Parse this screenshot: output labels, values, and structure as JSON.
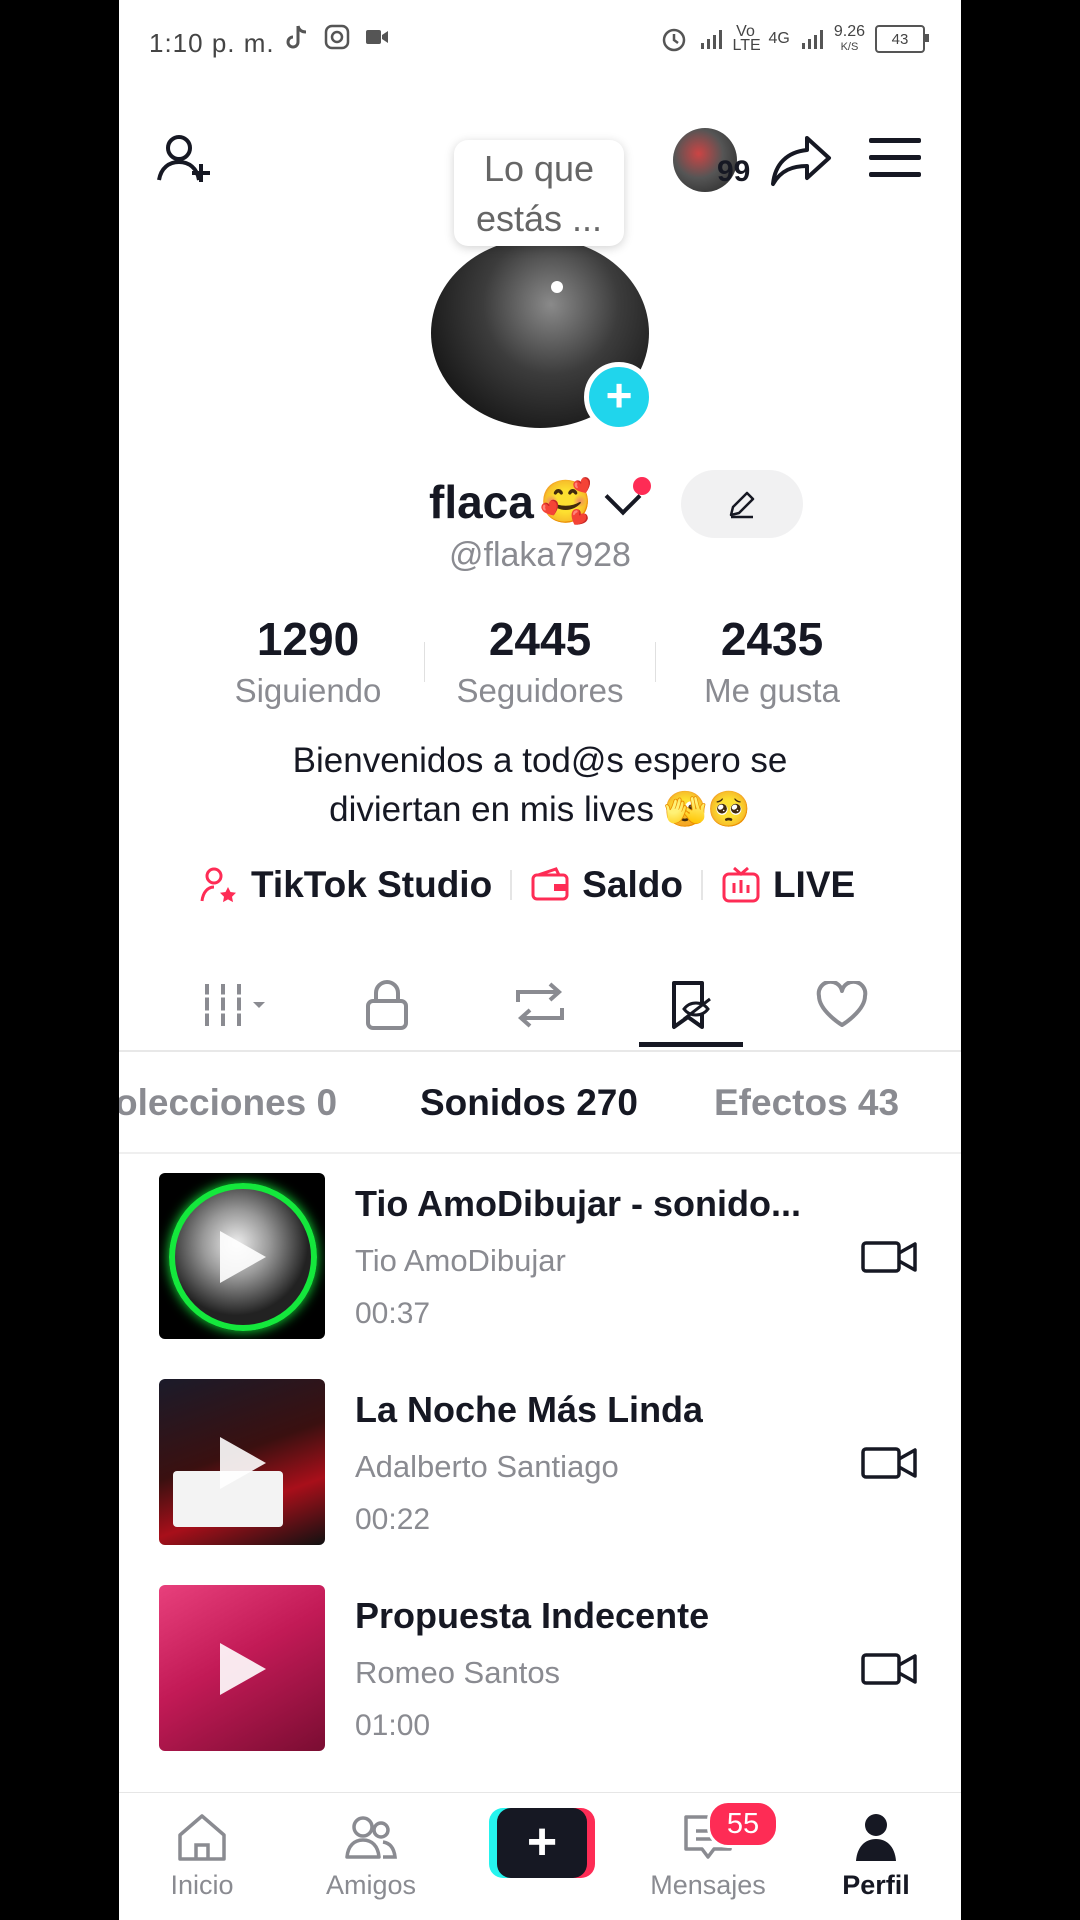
{
  "status_bar": {
    "time": "1:10 p. m.",
    "network": "Vo LTE",
    "network_gen": "4G",
    "speed": "9.26",
    "speed_unit": "K/S",
    "battery": "43"
  },
  "header": {
    "story_count": "99",
    "tooltip": "Lo que estás ..."
  },
  "profile": {
    "name": "flaca",
    "name_emoji": "🥰",
    "handle": "@flaka7928",
    "stats": [
      {
        "value": "1290",
        "label": "Siguiendo"
      },
      {
        "value": "2445",
        "label": "Seguidores"
      },
      {
        "value": "2435",
        "label": "Me gusta"
      }
    ],
    "bio_line1": "Bienvenidos a tod@s espero se",
    "bio_line2": "diviertan en mis lives 🫣🥺"
  },
  "links": {
    "studio": "TikTok Studio",
    "saldo": "Saldo",
    "live": "LIVE"
  },
  "subtabs": {
    "collections": "olecciones 0",
    "sounds": "Sonidos 270",
    "effects": "Efectos 43"
  },
  "sounds": [
    {
      "title": "Tio AmoDibujar - sonido...",
      "artist": "Tio AmoDibujar",
      "duration": "00:37"
    },
    {
      "title": "La Noche Más Linda",
      "artist": "Adalberto Santiago",
      "duration": "00:22"
    },
    {
      "title": "Propuesta Indecente",
      "artist": "Romeo Santos",
      "duration": "01:00"
    }
  ],
  "bottom_nav": {
    "home": "Inicio",
    "friends": "Amigos",
    "messages": "Mensajes",
    "messages_badge": "55",
    "profile": "Perfil"
  },
  "colors": {
    "accent": "#fe2c55",
    "teal": "#20d5ec",
    "text": "#161823",
    "muted": "#8a8b91"
  }
}
